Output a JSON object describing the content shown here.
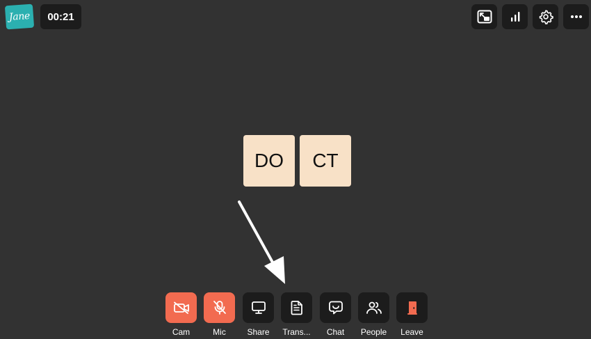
{
  "brand": {
    "logo_text": "Jane"
  },
  "call": {
    "timer": "00:21"
  },
  "top_controls": [
    {
      "icon": "picture-in-picture-icon"
    },
    {
      "icon": "network-stats-icon"
    },
    {
      "icon": "settings-gear-icon"
    },
    {
      "icon": "more-options-icon"
    }
  ],
  "participants": [
    {
      "initials": "DO"
    },
    {
      "initials": "CT"
    }
  ],
  "toolbar": {
    "cam_label": "Cam",
    "mic_label": "Mic",
    "share_label": "Share",
    "transcript_label": "Trans...",
    "chat_label": "Chat",
    "people_label": "People",
    "leave_label": "Leave"
  },
  "colors": {
    "background": "#323232",
    "button_dark": "#1c1c1c",
    "button_off_red": "#f26b50",
    "tile_bg": "#f8e1c7",
    "logo_teal": "#2bb0b0",
    "leave_icon": "#f26b50"
  }
}
